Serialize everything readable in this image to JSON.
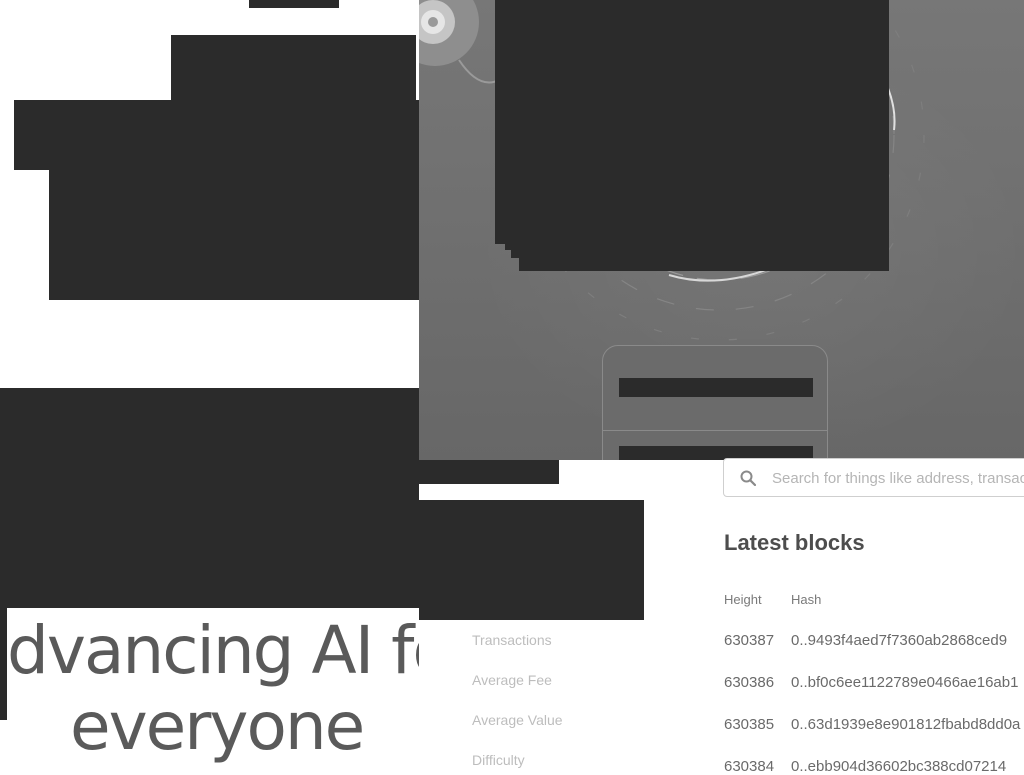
{
  "hero": {
    "headline_line1": "dvancing AI fo",
    "headline_line2": "everyone"
  },
  "stats": {
    "labels": [
      "Transactions",
      "Average Fee",
      "Average Value",
      "Difficulty"
    ]
  },
  "search": {
    "placeholder": "Search for things like address, transaction, block",
    "icon": "search-icon"
  },
  "blocks": {
    "title": "Latest blocks",
    "columns": {
      "height": "Height",
      "hash": "Hash"
    },
    "rows": [
      {
        "height": "630387",
        "hash": "0..9493f4aed7f7360ab2868ced9"
      },
      {
        "height": "630386",
        "hash": "0..bf0c6ee1122789e0466ae16ab1"
      },
      {
        "height": "630385",
        "hash": "0..63d1939e8e901812fbabd8dd0a"
      },
      {
        "height": "630384",
        "hash": "0..ebb904d36602bc388cd07214"
      }
    ]
  }
}
